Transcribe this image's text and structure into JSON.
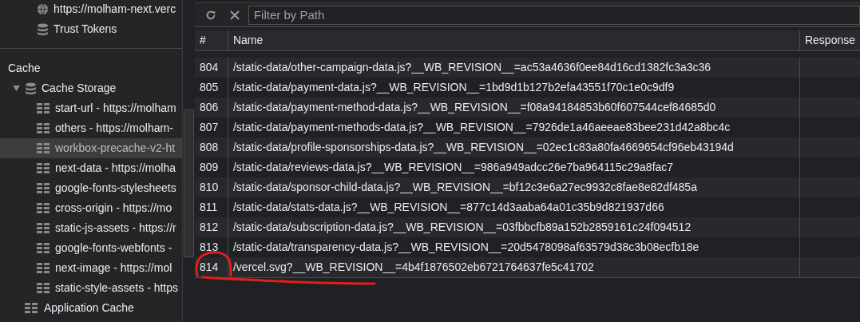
{
  "sidebar": {
    "items": [
      {
        "label": "https://molham-next.verc",
        "kind": "origin"
      },
      {
        "label": "Trust Tokens",
        "kind": "store"
      }
    ],
    "section": "Cache",
    "cache_storage": {
      "label": "Cache Storage",
      "expanded": true,
      "children": [
        {
          "label": "start-url - https://molham",
          "selected": false
        },
        {
          "label": "others - https://molham-",
          "selected": false
        },
        {
          "label": "workbox-precache-v2-ht",
          "selected": true
        },
        {
          "label": "next-data - https://molha",
          "selected": false
        },
        {
          "label": "google-fonts-stylesheets",
          "selected": false
        },
        {
          "label": "cross-origin - https://mo",
          "selected": false
        },
        {
          "label": "static-js-assets - https://r",
          "selected": false
        },
        {
          "label": "google-fonts-webfonts -",
          "selected": false
        },
        {
          "label": "next-image - https://mol",
          "selected": false
        },
        {
          "label": "static-style-assets - https",
          "selected": false
        }
      ]
    },
    "application_cache": "Application Cache"
  },
  "toolbar": {
    "filter": {
      "placeholder": "Filter by Path"
    }
  },
  "table": {
    "columns": [
      "#",
      "Name",
      "Response"
    ],
    "rows": [
      {
        "num": "804",
        "name": "/static-data/other-campaign-data.js?__WB_REVISION__=ac53a4636f0ee84d16cd1382fc3a3c36"
      },
      {
        "num": "805",
        "name": "/static-data/payment-data.js?__WB_REVISION__=1bd9d1b127b2efa43551f70c1e0c9df9"
      },
      {
        "num": "806",
        "name": "/static-data/payment-method-data.js?__WB_REVISION__=f08a94184853b60f607544cef84685d0"
      },
      {
        "num": "807",
        "name": "/static-data/payment-methods-data.js?__WB_REVISION__=7926de1a46aeeae83bee231d42a8bc4c"
      },
      {
        "num": "808",
        "name": "/static-data/profile-sponsorships-data.js?__WB_REVISION__=02ec1c83a80fa4669654cf96eb43194d"
      },
      {
        "num": "809",
        "name": "/static-data/reviews-data.js?__WB_REVISION__=986a949adcc26e7ba964115c29a8fac7"
      },
      {
        "num": "810",
        "name": "/static-data/sponsor-child-data.js?__WB_REVISION__=bf12c3e6a27ec9932c8fae8e82df485a"
      },
      {
        "num": "811",
        "name": "/static-data/stats-data.js?__WB_REVISION__=877c14d3aaba64a01c35b9d821937d66"
      },
      {
        "num": "812",
        "name": "/static-data/subscription-data.js?__WB_REVISION__=03fbbcfb89a152b2859161c24f094512"
      },
      {
        "num": "813",
        "name": "/static-data/transparency-data.js?__WB_REVISION__=20d5478098af63579d38c3b08ecfb18e"
      },
      {
        "num": "814",
        "name": "/vercel.svg?__WB_REVISION__=4b4f1876502eb6721764637fe5c41702"
      }
    ]
  },
  "annotation": {
    "color": "#e0201c"
  }
}
